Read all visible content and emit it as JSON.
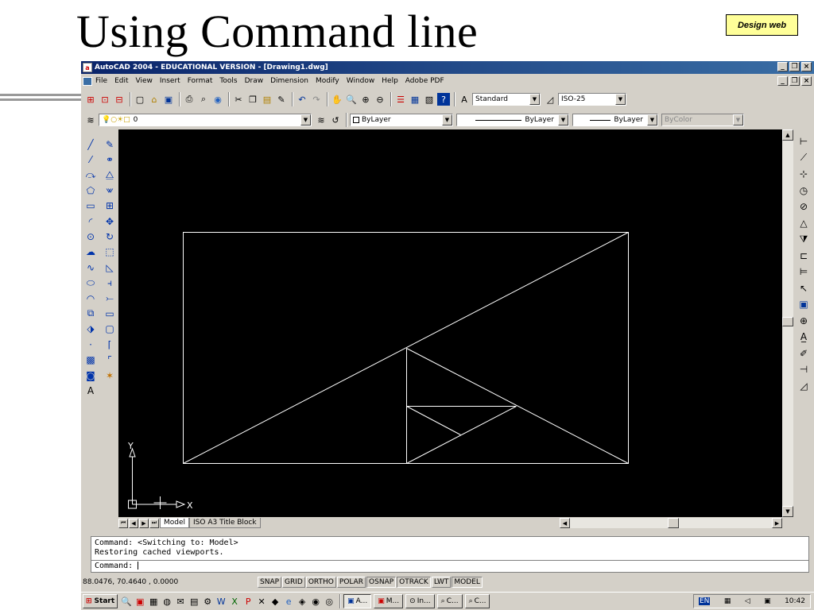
{
  "slide": {
    "title": "Using Command line",
    "badge": "Design web"
  },
  "window": {
    "title": "AutoCAD 2004 - EDUCATIONAL VERSION - [Drawing1.dwg]",
    "minimize": "_",
    "restore": "❐",
    "close": "×"
  },
  "menu": [
    "File",
    "Edit",
    "View",
    "Insert",
    "Format",
    "Tools",
    "Draw",
    "Dimension",
    "Modify",
    "Window",
    "Help",
    "Adobe PDF"
  ],
  "toolbar": {
    "text_style": "Standard",
    "dim_style": "ISO-25"
  },
  "layers": {
    "current_layer": "0",
    "color": "ByLayer",
    "linetype": "ByLayer",
    "lineweight": "ByLayer",
    "plot_style": "ByColor"
  },
  "ucs": {
    "y_label": "Y",
    "x_label": "X"
  },
  "layout_tabs": [
    "Model",
    "ISO A3 Title Block"
  ],
  "command_history": [
    "Command:  <Switching to: Model>",
    "Restoring cached viewports."
  ],
  "command_prompt": "Command:",
  "status": {
    "coordinates": "88.0476,  70.4640 , 0.0000",
    "buttons": [
      "SNAP",
      "GRID",
      "ORTHO",
      "POLAR",
      "OSNAP",
      "OTRACK",
      "LWT",
      "MODEL"
    ],
    "active": [
      "OSNAP",
      "OTRACK",
      "MODEL"
    ]
  },
  "taskbar": {
    "start": "Start",
    "tasks": [
      "A...",
      "M...",
      "In...",
      "C...",
      "C..."
    ],
    "lang": "EN",
    "clock": "10:42"
  },
  "colors": {
    "title_bar": "#0a246a",
    "canvas": "#000000",
    "badge_bg": "#ffff99"
  }
}
